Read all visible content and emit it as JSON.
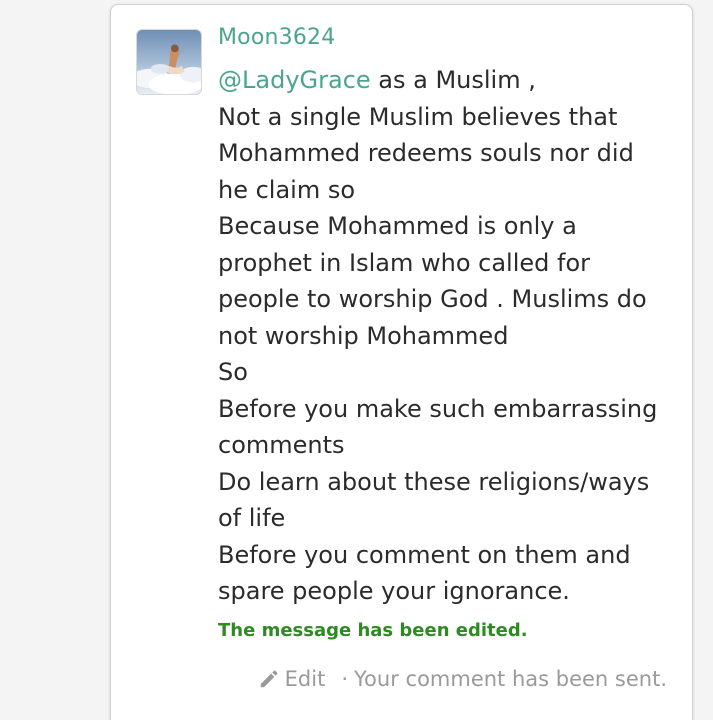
{
  "comment": {
    "username": "Moon3624",
    "mention": "@LadyGrace",
    "first_line_rest": " as a Muslim ,",
    "lines": [
      "Not a single Muslim believes that",
      "Mohammed redeems souls nor did",
      "he claim so",
      "Because Mohammed is only a",
      "prophet in Islam who called for",
      "people to worship God . Muslims do",
      "not worship Mohammed",
      "So",
      "Before you make such embarrassing",
      "comments",
      "Do learn about these religions/ways",
      "of life",
      "Before you comment on them and",
      "spare people your ignorance."
    ],
    "edited_notice": "The message has been edited.",
    "edit_label": "Edit",
    "separator": "·",
    "sent_status": "Your comment has been sent."
  },
  "icons": {
    "avatar": "user-avatar-clouds-image",
    "edit": "pencil-icon"
  },
  "colors": {
    "username": "#4aa68b",
    "mention": "#4aa68b",
    "edited_notice": "#2e8b22",
    "body_text": "#2b2b2b",
    "footer_text": "#9a9a9a"
  }
}
